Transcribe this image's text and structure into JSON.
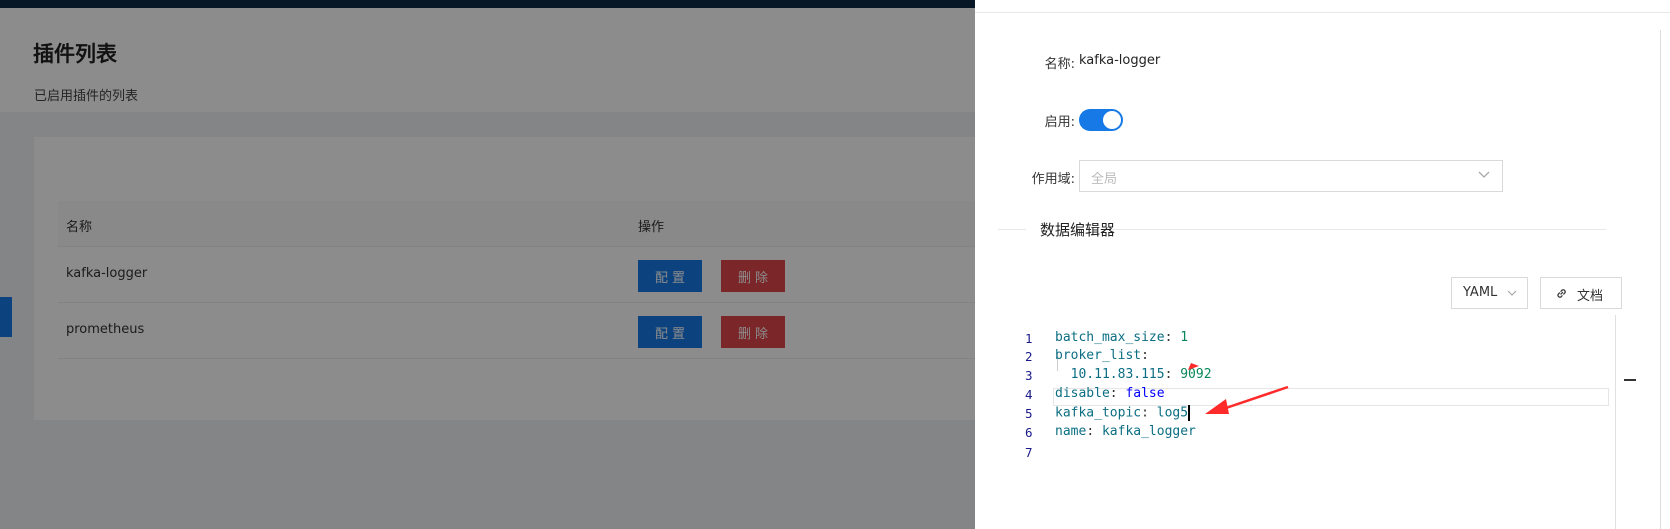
{
  "page": {
    "title": "插件列表",
    "subtitle": "已启用插件的列表"
  },
  "table": {
    "columns": [
      "名称",
      "操作"
    ],
    "rows": [
      {
        "name": "kafka-logger",
        "config_label": "配置",
        "delete_label": "删除"
      },
      {
        "name": "prometheus",
        "config_label": "配置",
        "delete_label": "删除"
      }
    ]
  },
  "drawer": {
    "name_label": "名称:",
    "name_value": "kafka-logger",
    "enable_label": "启用:",
    "enabled": true,
    "scope_label": "作用域:",
    "scope_value": "全局",
    "section_title": "数据编辑器",
    "format_value": "YAML",
    "doc_label": "文档",
    "code_lines": [
      {
        "num": "1",
        "key": "batch_max_size",
        "sep": ": ",
        "val": "1",
        "type": "n"
      },
      {
        "num": "2",
        "key": "broker_list",
        "sep": ":",
        "val": "",
        "type": "p"
      },
      {
        "num": "3",
        "key": "  10.11.83.115",
        "sep": ": ",
        "val": "9092",
        "type": "n"
      },
      {
        "num": "4",
        "key": "disable",
        "sep": ": ",
        "val": "false",
        "type": "b"
      },
      {
        "num": "5",
        "key": "kafka_topic",
        "sep": ": ",
        "val": "log5",
        "type": "s"
      },
      {
        "num": "6",
        "key": "name",
        "sep": ": ",
        "val": "kafka_logger",
        "type": "s"
      },
      {
        "num": "7",
        "key": "",
        "sep": "",
        "val": "",
        "type": "p"
      }
    ]
  },
  "colors": {
    "primary": "#1779e6",
    "danger": "#e0454a",
    "annotation": "#ff2b2b"
  }
}
